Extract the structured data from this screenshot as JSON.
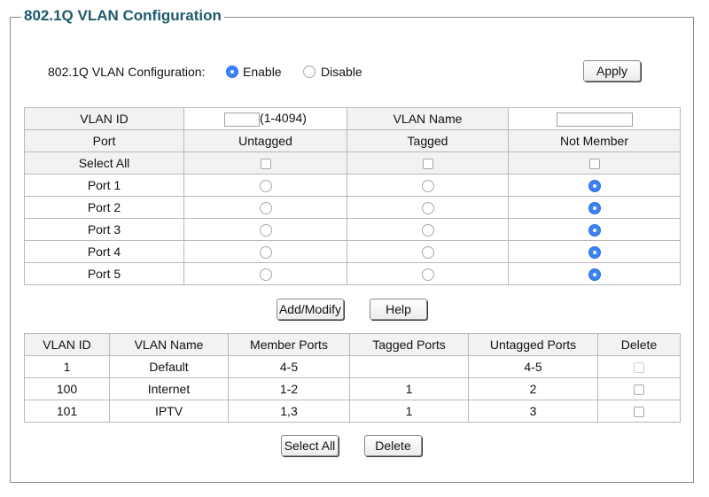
{
  "panel": {
    "title": "802.1Q VLAN Configuration"
  },
  "config": {
    "label": "802.1Q VLAN Configuration:",
    "enable_label": "Enable",
    "disable_label": "Disable",
    "selected": "Enable",
    "apply_label": "Apply"
  },
  "editor": {
    "vlan_id_label": "VLAN ID",
    "vlan_id_value": "",
    "vlan_id_range": "(1-4094)",
    "vlan_name_label": "VLAN Name",
    "vlan_name_value": "",
    "headers": [
      "Port",
      "Untagged",
      "Tagged",
      "Not Member"
    ],
    "select_all_label": "Select All",
    "ports": [
      {
        "name": "Port 1",
        "membership": "Not Member"
      },
      {
        "name": "Port 2",
        "membership": "Not Member"
      },
      {
        "name": "Port 3",
        "membership": "Not Member"
      },
      {
        "name": "Port 4",
        "membership": "Not Member"
      },
      {
        "name": "Port 5",
        "membership": "Not Member"
      }
    ],
    "add_modify_label": "Add/Modify",
    "help_label": "Help"
  },
  "vlan_table": {
    "headers": [
      "VLAN ID",
      "VLAN Name",
      "Member Ports",
      "Tagged Ports",
      "Untagged Ports",
      "Delete"
    ],
    "rows": [
      {
        "id": "1",
        "name": "Default",
        "member": "4-5",
        "tagged": "",
        "untagged": "4-5"
      },
      {
        "id": "100",
        "name": "Internet",
        "member": "1-2",
        "tagged": "1",
        "untagged": "2"
      },
      {
        "id": "101",
        "name": "IPTV",
        "member": "1,3",
        "tagged": "1",
        "untagged": "3"
      }
    ],
    "select_all_label": "Select All",
    "delete_label": "Delete"
  }
}
